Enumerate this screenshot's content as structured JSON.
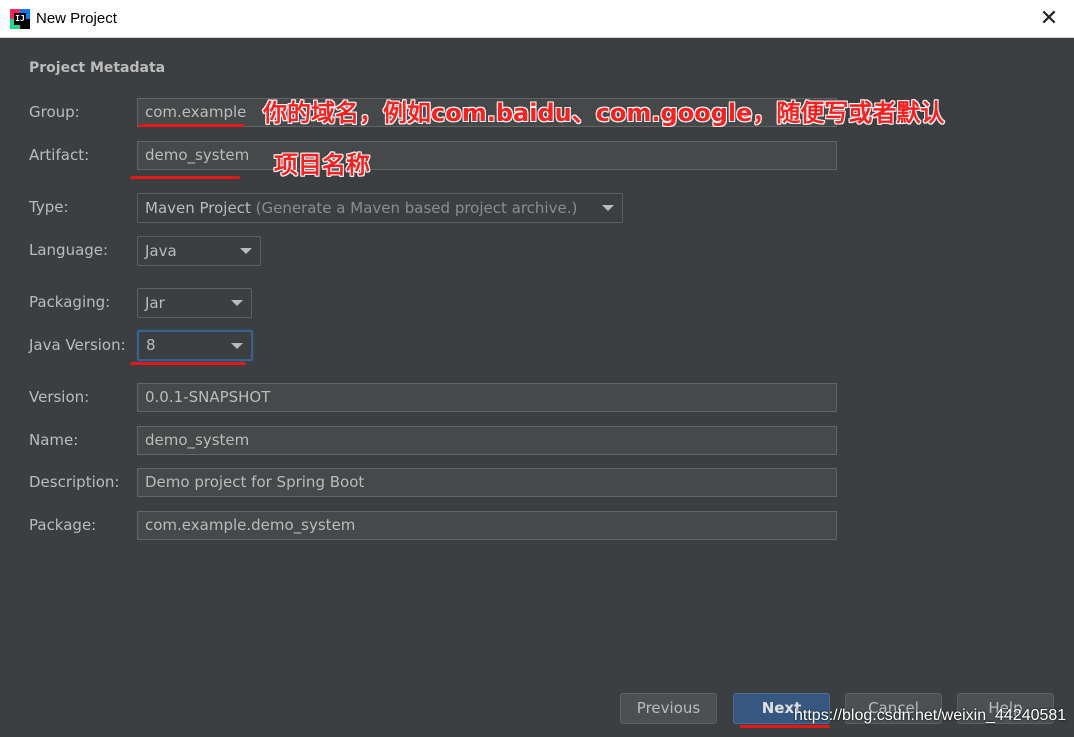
{
  "window": {
    "title": "New Project",
    "app_icon": "intellij-idea-icon",
    "close_glyph": "✕"
  },
  "section": {
    "title": "Project Metadata"
  },
  "fields": {
    "group": {
      "label": "Group:",
      "value": "com.example"
    },
    "artifact": {
      "label": "Artifact:",
      "value": "demo_system"
    },
    "type": {
      "label": "Type:",
      "value": "Maven Project",
      "hint": "(Generate a Maven based project archive.)"
    },
    "language": {
      "label": "Language:",
      "value": "Java"
    },
    "packaging": {
      "label": "Packaging:",
      "value": "Jar"
    },
    "java_version": {
      "label": "Java Version:",
      "value": "8"
    },
    "version": {
      "label": "Version:",
      "value": "0.0.1-SNAPSHOT"
    },
    "name": {
      "label": "Name:",
      "value": "demo_system"
    },
    "description": {
      "label": "Description:",
      "value": "Demo project for Spring Boot"
    },
    "package": {
      "label": "Package:",
      "value": "com.example.demo_system"
    }
  },
  "annotations": {
    "group_note": "你的域名，例如com.baidu、com.google，随便写或者默认",
    "artifact_note": "项目名称"
  },
  "buttons": {
    "previous": "Previous",
    "next": "Next",
    "cancel": "Cancel",
    "help": "Help"
  },
  "watermark": "https://blog.csdn.net/weixin_44240581",
  "colors": {
    "background": "#3c3f41",
    "field_bg": "#45494a",
    "primary_button": "#365880",
    "annotation": "#ff1e1e"
  }
}
